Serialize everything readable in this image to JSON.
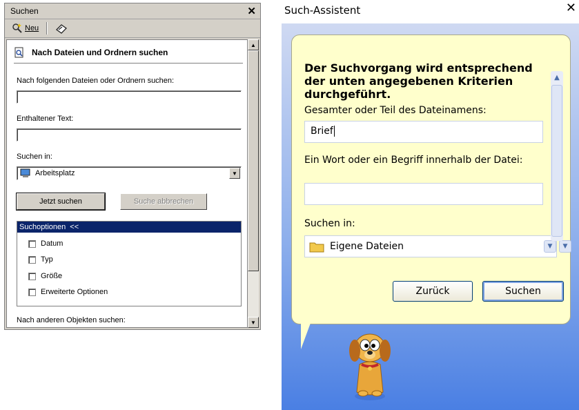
{
  "left": {
    "title": "Suchen",
    "toolbar": {
      "new_label": "Neu"
    },
    "heading": "Nach Dateien und Ordnern suchen",
    "files_label": "Nach folgenden Dateien oder Ordnern suchen:",
    "files_value": "",
    "text_label": "Enthaltener Text:",
    "text_value": "",
    "searchin_label": "Suchen in:",
    "searchin_value": "Arbeitsplatz",
    "search_now": "Jetzt suchen",
    "cancel_search": "Suche abbrechen",
    "options_header": "Suchoptionen",
    "options_chevron": "<<",
    "options": [
      "Datum",
      "Typ",
      "Größe",
      "Erweiterte Optionen"
    ],
    "other_label": "Nach anderen Objekten suchen:"
  },
  "right": {
    "title": "Such-Assistent",
    "heading": "Der Suchvorgang wird entsprechend der unten angegebenen Kriterien durchgeführt.",
    "name_label": "Gesamter oder Teil des Dateinamens:",
    "name_value": "Brief",
    "word_label": "Ein Wort oder ein Begriff innerhalb der Datei:",
    "word_value": "",
    "searchin_label": "Suchen in:",
    "searchin_value": "Eigene Dateien",
    "back_label": "Zurück",
    "search_label": "Suchen"
  },
  "colors": {
    "selection_blue": "#0a246a",
    "xp_bubble": "#ffffcc",
    "xp_blue": "#4a7fe3"
  },
  "icons": [
    "search-doc-icon",
    "new-search-icon",
    "history-icon",
    "computer-icon",
    "folder-icon",
    "dog-mascot"
  ]
}
